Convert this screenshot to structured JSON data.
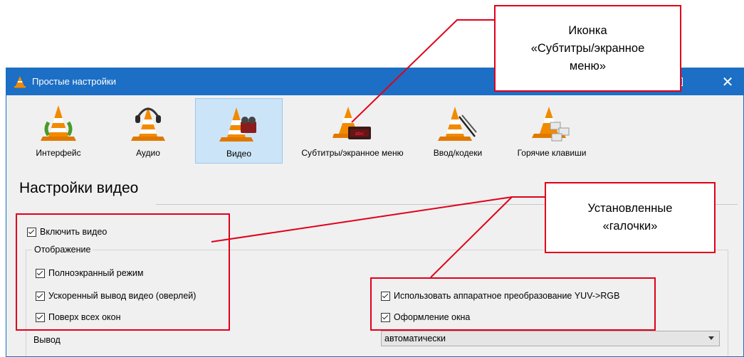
{
  "window": {
    "title": "Простые настройки",
    "close_glyph": "✕"
  },
  "categories": [
    {
      "label": "Интерфейс",
      "icon": "interface-cone-icon",
      "active": false
    },
    {
      "label": "Аудио",
      "icon": "audio-headphones-cone-icon",
      "active": false
    },
    {
      "label": "Видео",
      "icon": "video-cone-icon",
      "active": true
    },
    {
      "label": "Субтитры/экранное меню",
      "icon": "subtitles-cone-icon",
      "active": false
    },
    {
      "label": "Ввод/кодеки",
      "icon": "input-codecs-cone-icon",
      "active": false
    },
    {
      "label": "Горячие клавиши",
      "icon": "hotkeys-cone-icon",
      "active": false
    }
  ],
  "section": {
    "title": "Настройки видео"
  },
  "settings": {
    "enable_video": {
      "label": "Включить видео",
      "checked": true
    },
    "display_group": "Отображение",
    "fullscreen": {
      "label": "Полноэкранный режим",
      "checked": true
    },
    "overlay": {
      "label": "Ускоренный вывод видео (оверлей)",
      "checked": true
    },
    "always_on_top": {
      "label": "Поверх всех окон",
      "checked": true
    },
    "yuv_rgb": {
      "label": "Использовать аппаратное преобразование YUV->RGB",
      "checked": true
    },
    "window_decorations": {
      "label": "Оформление окна",
      "checked": true
    },
    "output_label": "Вывод",
    "output_value": "автоматически"
  },
  "annotations": {
    "icon_callout_lines": [
      "Иконка",
      "«Субтитры/экранное",
      "меню»"
    ],
    "checks_callout_lines": [
      "Установленные",
      "«галочки»"
    ],
    "color": "#e0001a"
  }
}
